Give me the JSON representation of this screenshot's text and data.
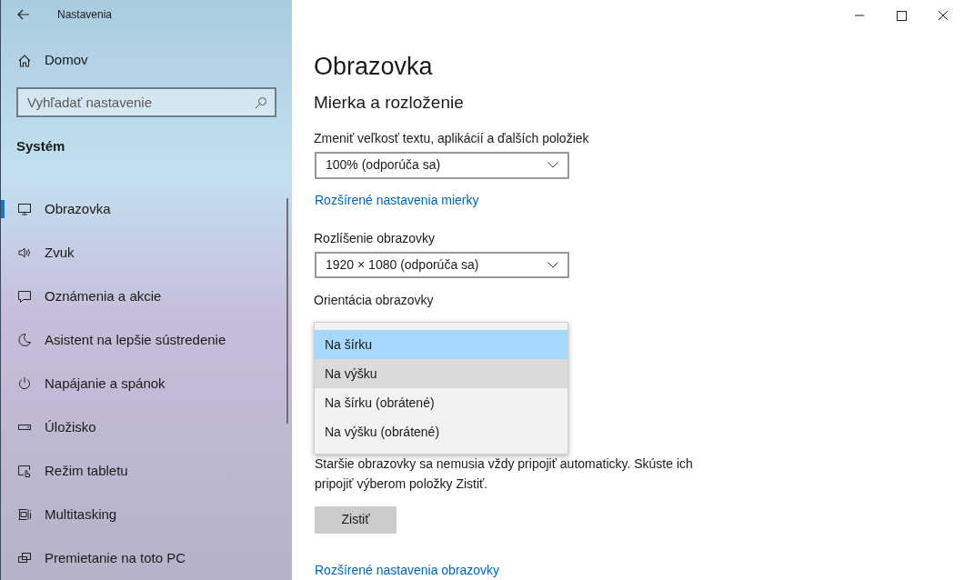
{
  "window": {
    "title": "Nastavenia"
  },
  "sidebar": {
    "home": "Domov",
    "search": {
      "placeholder": "Vyhľadať nastavenie"
    },
    "section": "Systém",
    "items": [
      {
        "label": "Obrazovka",
        "selected": true
      },
      {
        "label": "Zvuk",
        "selected": false
      },
      {
        "label": "Oznámenia a akcie",
        "selected": false
      },
      {
        "label": "Asistent na lepšie sústredenie",
        "selected": false
      },
      {
        "label": "Napájanie a spánok",
        "selected": false
      },
      {
        "label": "Úložisko",
        "selected": false
      },
      {
        "label": "Režim tabletu",
        "selected": false
      },
      {
        "label": "Multitasking",
        "selected": false
      },
      {
        "label": "Premietanie na toto PC",
        "selected": false
      }
    ]
  },
  "page": {
    "title": "Obrazovka",
    "section": "Mierka a rozloženie",
    "scale": {
      "label": "Zmeniť veľkosť textu, aplikácií a ďalších položiek",
      "value": "100% (odporúča sa)"
    },
    "scale_link": "Rozšírené nastavenia mierky",
    "resolution": {
      "label": "Rozlíšenie obrazovky",
      "value": "1920 × 1080 (odporúča sa)"
    },
    "orientation": {
      "label": "Orientácia obrazovky",
      "options": [
        {
          "label": "Na šírku",
          "selected": true,
          "hovered": false
        },
        {
          "label": "Na výšku",
          "selected": false,
          "hovered": true
        },
        {
          "label": "Na šírku (obrátené)",
          "selected": false,
          "hovered": false
        },
        {
          "label": "Na výšku (obrátené)",
          "selected": false,
          "hovered": false
        }
      ]
    },
    "detect_text": "Staršie obrazovky sa nemusia vždy pripojiť automaticky. Skúste ich pripojiť výberom položky Zistiť.",
    "detect_button": "Zistiť",
    "advanced_link": "Rozšírené nastavenia obrazovky"
  }
}
